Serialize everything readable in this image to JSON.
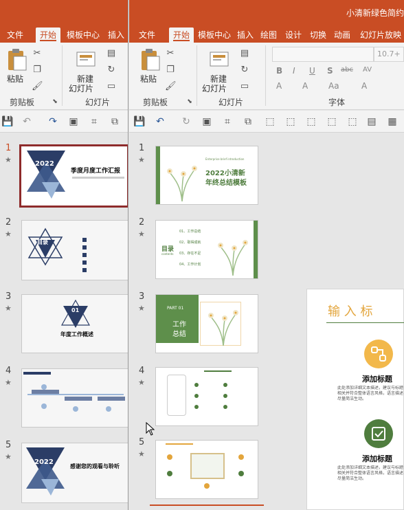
{
  "colors": {
    "accent": "#c94d24",
    "ppt_green": "#5e8f4b",
    "dark_navy": "#2b3d66",
    "gold": "#e3a53c"
  },
  "window_a": {
    "tabs": [
      "文件",
      "开始",
      "模板中心",
      "插入"
    ],
    "active_tab": "开始",
    "ribbon": {
      "paste_label": "粘贴",
      "clipboard_group": "剪贴板",
      "new_slide_label_1": "新建",
      "new_slide_label_2": "幻灯片",
      "slides_group": "幻灯片"
    },
    "slides": [
      {
        "number": "1",
        "title": "季度月度工作汇报",
        "badge": "2022"
      },
      {
        "number": "2",
        "badge": "目录"
      },
      {
        "number": "3",
        "badge": "01",
        "title": "年度工作概述"
      },
      {
        "number": "4"
      },
      {
        "number": "5",
        "badge": "2022",
        "title": "感谢您的观看与聆听"
      }
    ]
  },
  "window_b": {
    "title": "小清新绿色简约",
    "tabs": [
      "文件",
      "开始",
      "模板中心",
      "插入",
      "绘图",
      "设计",
      "切换",
      "动画",
      "幻灯片放映"
    ],
    "active_tab": "开始",
    "ribbon": {
      "paste_label": "粘贴",
      "clipboard_group": "剪贴板",
      "new_slide_label_1": "新建",
      "new_slide_label_2": "幻灯片",
      "slides_group": "幻灯片",
      "font_group": "字体",
      "font_size": "10.7+",
      "format_buttons": [
        "B",
        "I",
        "U",
        "S",
        "abc",
        "AV"
      ],
      "font_buttons_row3": [
        "A",
        "A",
        "Aa",
        "A"
      ]
    },
    "slides": [
      {
        "number": "1",
        "subtitle": "Enterprise brief introduction",
        "title_line1": "2022小清新",
        "title_line2": "年终总结模板"
      },
      {
        "number": "2",
        "heading": "目录",
        "sub": "contents",
        "items": [
          "01、工作总结",
          "02、取得成就",
          "03、存在不足",
          "04、工作计划"
        ]
      },
      {
        "number": "3",
        "part": "PART 01",
        "title_line1": "工作",
        "title_line2": "总结"
      },
      {
        "number": "4"
      },
      {
        "number": "5"
      }
    ],
    "big_slide": {
      "title": "输 入 标",
      "item1_title": "添加标题",
      "item1_body": "此处添加详细文本描述，建议与标题相关并符合整体语言风格，语言描述尽量简洁生动。",
      "item2_title": "添加标题",
      "item2_body": "此处添加详细文本描述，建议与标题相关并符合整体语言风格，语言描述尽量简洁生动。"
    }
  }
}
